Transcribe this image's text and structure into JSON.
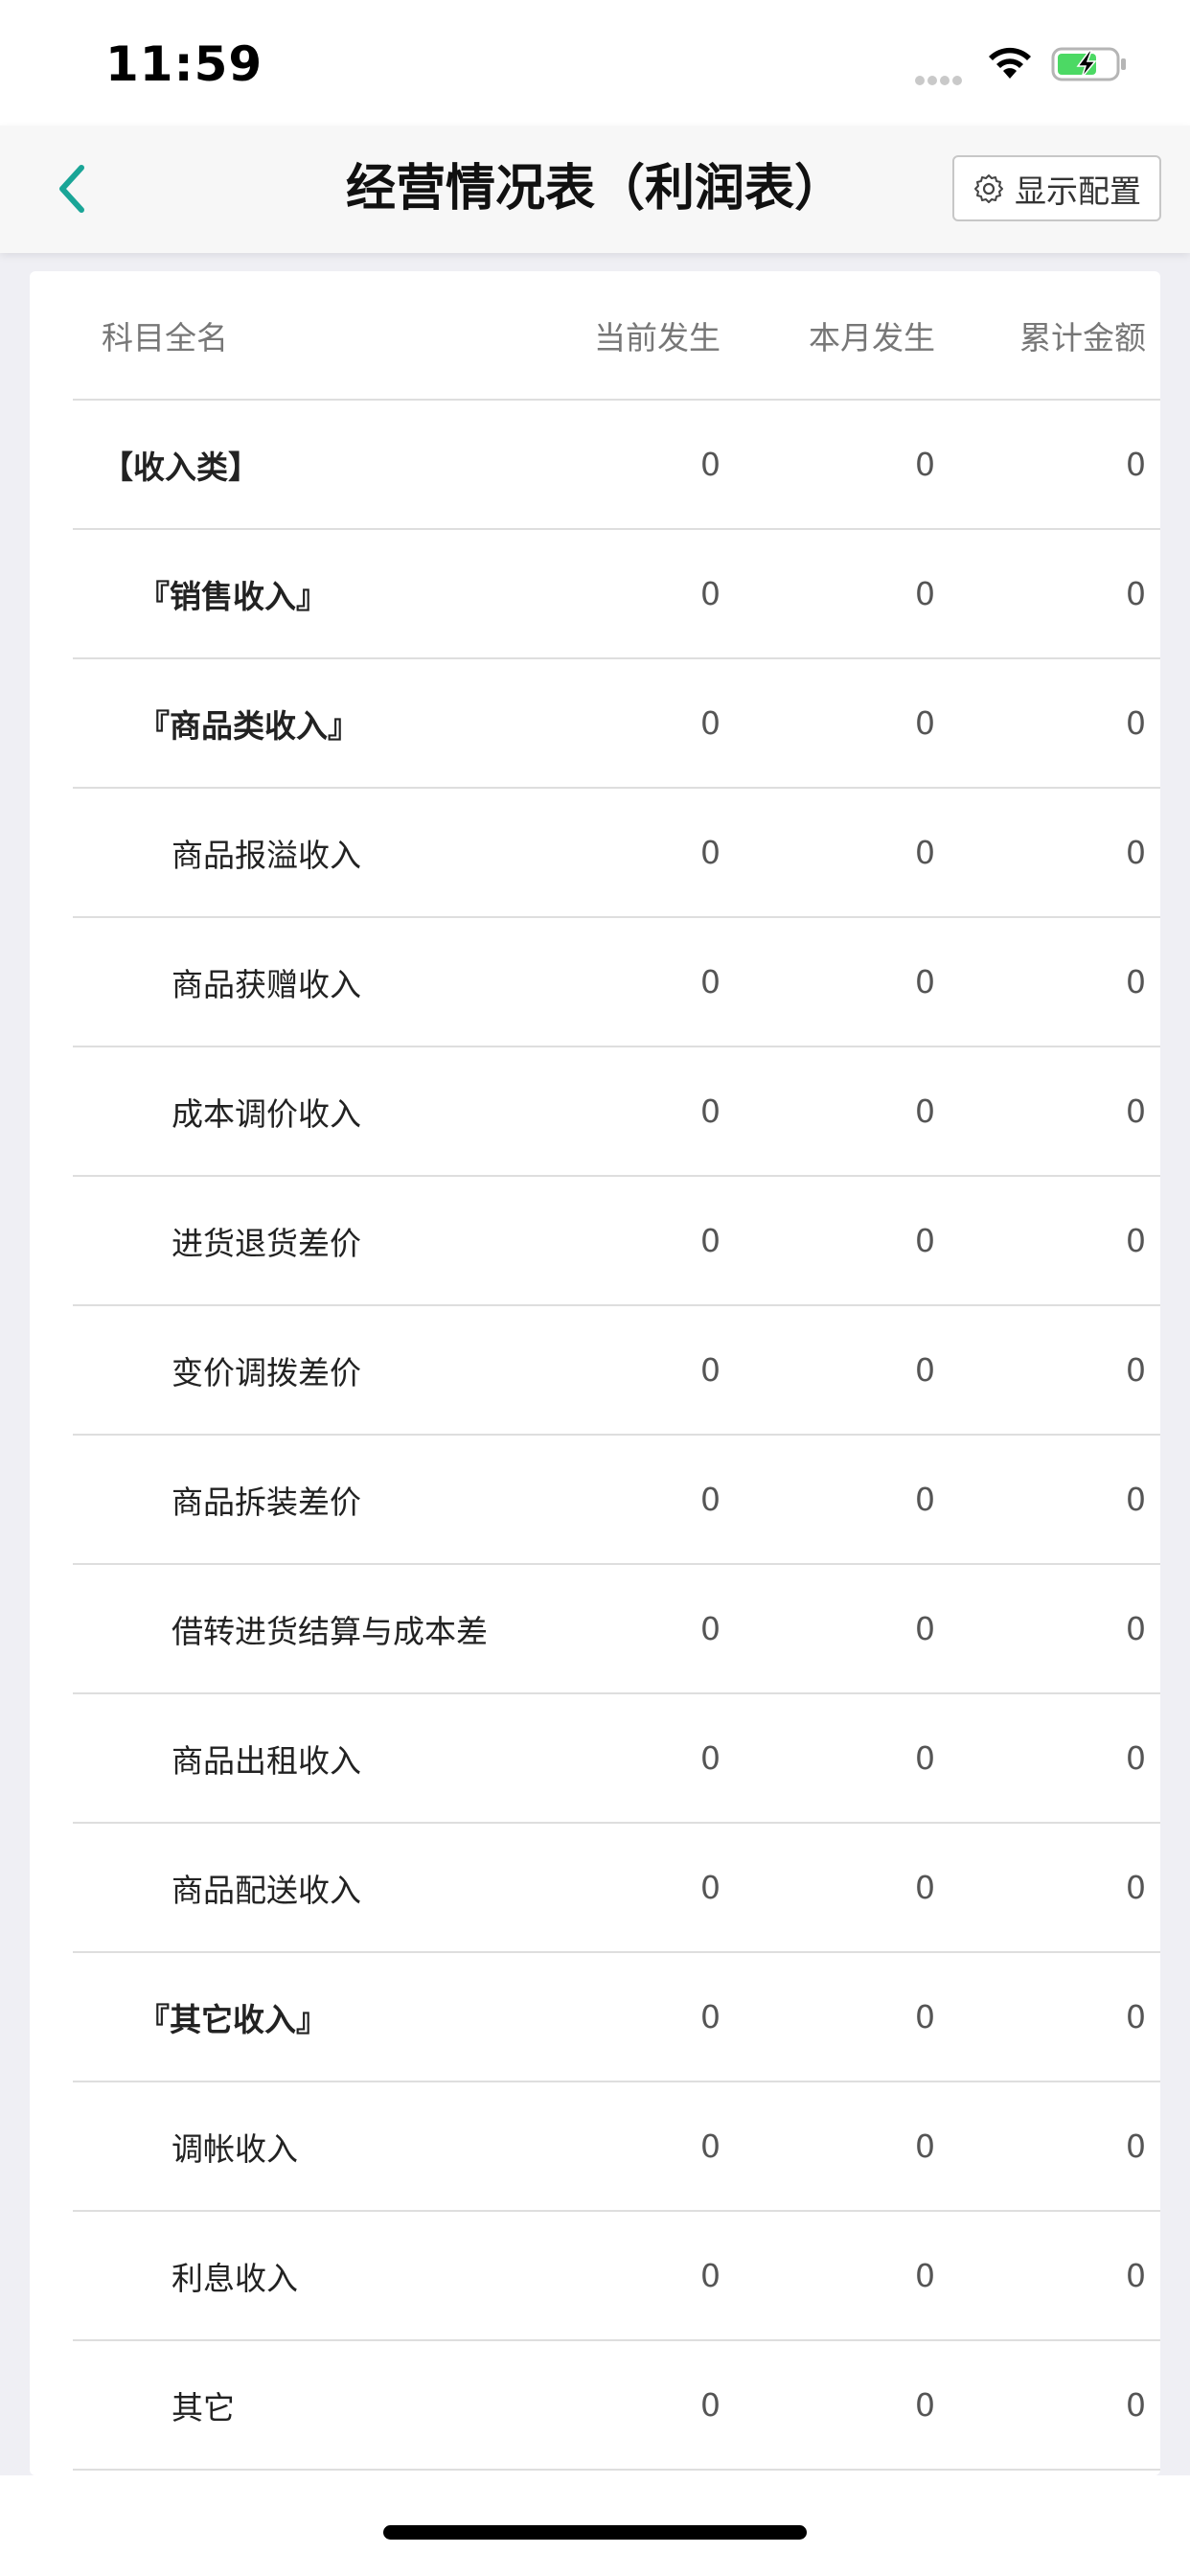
{
  "status_bar": {
    "time": "11:59"
  },
  "nav": {
    "title": "经营情况表（利润表）",
    "config_label": "显示配置",
    "accent_color": "#1aa597"
  },
  "table": {
    "headers": {
      "name": "科目全名",
      "current": "当前发生",
      "month": "本月发生",
      "total": "累计金额"
    },
    "rows": [
      {
        "name": "【收入类】",
        "current": "0",
        "month": "0",
        "total": "0",
        "level": 0
      },
      {
        "name": "『销售收入』",
        "current": "0",
        "month": "0",
        "total": "0",
        "level": 1
      },
      {
        "name": "『商品类收入』",
        "current": "0",
        "month": "0",
        "total": "0",
        "level": 1
      },
      {
        "name": "商品报溢收入",
        "current": "0",
        "month": "0",
        "total": "0",
        "level": 2
      },
      {
        "name": "商品获赠收入",
        "current": "0",
        "month": "0",
        "total": "0",
        "level": 2
      },
      {
        "name": "成本调价收入",
        "current": "0",
        "month": "0",
        "total": "0",
        "level": 2
      },
      {
        "name": "进货退货差价",
        "current": "0",
        "month": "0",
        "total": "0",
        "level": 2
      },
      {
        "name": "变价调拨差价",
        "current": "0",
        "month": "0",
        "total": "0",
        "level": 2
      },
      {
        "name": "商品拆装差价",
        "current": "0",
        "month": "0",
        "total": "0",
        "level": 2
      },
      {
        "name": "借转进货结算与成本差",
        "current": "0",
        "month": "0",
        "total": "0",
        "level": 2
      },
      {
        "name": "商品出租收入",
        "current": "0",
        "month": "0",
        "total": "0",
        "level": 2
      },
      {
        "name": "商品配送收入",
        "current": "0",
        "month": "0",
        "total": "0",
        "level": 2
      },
      {
        "name": "『其它收入』",
        "current": "0",
        "month": "0",
        "total": "0",
        "level": 1
      },
      {
        "name": "调帐收入",
        "current": "0",
        "month": "0",
        "total": "0",
        "level": 2
      },
      {
        "name": "利息收入",
        "current": "0",
        "month": "0",
        "total": "0",
        "level": 2
      },
      {
        "name": "其它",
        "current": "0",
        "month": "0",
        "total": "0",
        "level": 2
      }
    ]
  }
}
